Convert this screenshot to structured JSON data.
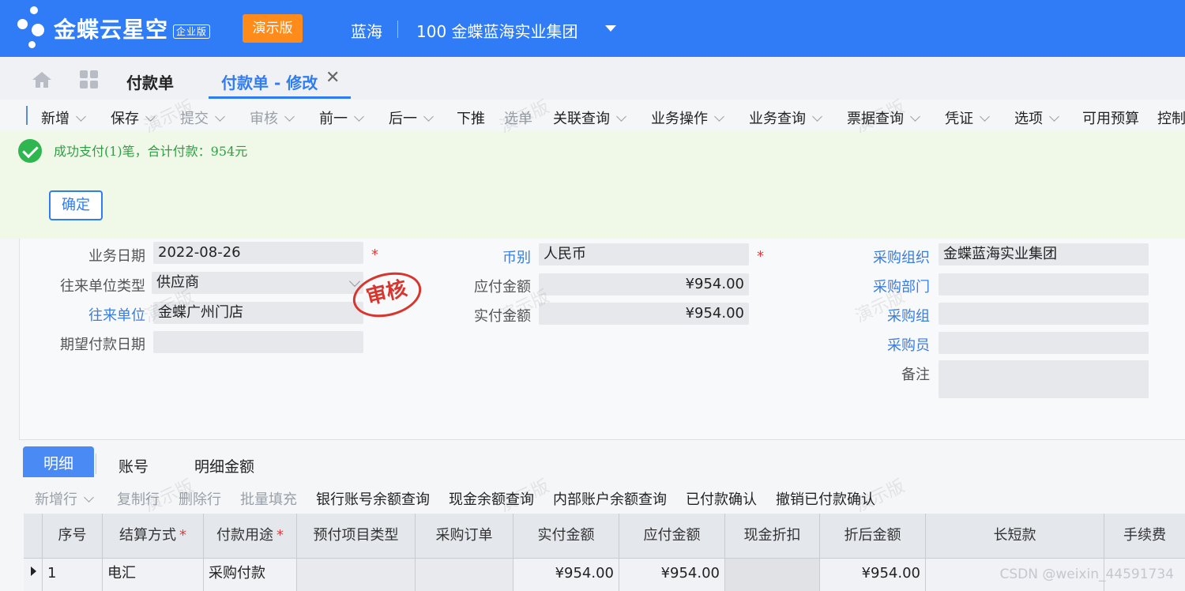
{
  "header": {
    "brand": "金蝶云星空",
    "edition_badge": "企业版",
    "demo_badge": "演示版",
    "user": "蓝海",
    "org": "100  金蝶蓝海实业集团",
    "colors": {
      "primary": "#2f7cf6",
      "demo": "#ff8c1a"
    }
  },
  "tabs": [
    {
      "label": "付款单"
    },
    {
      "label": "付款单 - 修改"
    }
  ],
  "toolbar": [
    {
      "label": "新增",
      "disabled": false
    },
    {
      "label": "保存",
      "disabled": false
    },
    {
      "label": "提交",
      "disabled": true
    },
    {
      "label": "审核",
      "disabled": true
    },
    {
      "label": "前一",
      "disabled": false
    },
    {
      "label": "后一",
      "disabled": false
    },
    {
      "label": "下推",
      "disabled": false
    },
    {
      "label": "选单",
      "disabled": true
    },
    {
      "label": "关联查询",
      "disabled": false
    },
    {
      "label": "业务操作",
      "disabled": false
    },
    {
      "label": "业务查询",
      "disabled": false
    },
    {
      "label": "票据查询",
      "disabled": false
    },
    {
      "label": "凭证",
      "disabled": false
    },
    {
      "label": "选项",
      "disabled": false
    },
    {
      "label": "可用预算",
      "disabled": false
    },
    {
      "label": "控制",
      "disabled": false
    }
  ],
  "message": {
    "text": "成功支付(1)笔，合计付款：954元",
    "confirm_label": "确定"
  },
  "form": {
    "biz_date": {
      "label": "业务日期",
      "value": "2022-08-26"
    },
    "partner_type": {
      "label": "往来单位类型",
      "value": "供应商"
    },
    "partner": {
      "label": "往来单位",
      "value": "金蝶广州门店"
    },
    "expected_date": {
      "label": "期望付款日期",
      "value": ""
    },
    "currency": {
      "label": "币别",
      "value": "人民币"
    },
    "payable": {
      "label": "应付金额",
      "value": "¥954.00"
    },
    "paid": {
      "label": "实付金额",
      "value": "¥954.00"
    },
    "purchase_org": {
      "label": "采购组织",
      "value": "金蝶蓝海实业集团"
    },
    "purchase_dept": {
      "label": "采购部门",
      "value": ""
    },
    "purchase_group": {
      "label": "采购组",
      "value": ""
    },
    "buyer": {
      "label": "采购员",
      "value": ""
    },
    "remark": {
      "label": "备注",
      "value": ""
    },
    "required_mark": "*",
    "stamp": "审核"
  },
  "detail_tabs": [
    {
      "label": "明细"
    },
    {
      "label": "账号"
    },
    {
      "label": "明细金额"
    }
  ],
  "sub_toolbar": [
    {
      "label": "新增行",
      "disabled": true
    },
    {
      "label": "复制行",
      "disabled": true
    },
    {
      "label": "删除行",
      "disabled": true
    },
    {
      "label": "批量填充",
      "disabled": true
    },
    {
      "label": "银行账号余额查询",
      "disabled": false
    },
    {
      "label": "现金余额查询",
      "disabled": false
    },
    {
      "label": "内部账户余额查询",
      "disabled": false
    },
    {
      "label": "已付款确认",
      "disabled": false
    },
    {
      "label": "撤销已付款确认",
      "disabled": false
    }
  ],
  "grid": {
    "columns": [
      "序号",
      "结算方式",
      "付款用途",
      "预付项目类型",
      "采购订单",
      "实付金额",
      "应付金额",
      "现金折扣",
      "折后金额",
      "长短款",
      "手续费"
    ],
    "required_mark": "*",
    "rows": [
      [
        "1",
        "电汇",
        "采购付款",
        "",
        "",
        "¥954.00",
        "¥954.00",
        "",
        "¥954.00",
        "",
        ""
      ]
    ]
  },
  "watermark": "演示版",
  "footer_watermark": "CSDN @weixin_44591734"
}
